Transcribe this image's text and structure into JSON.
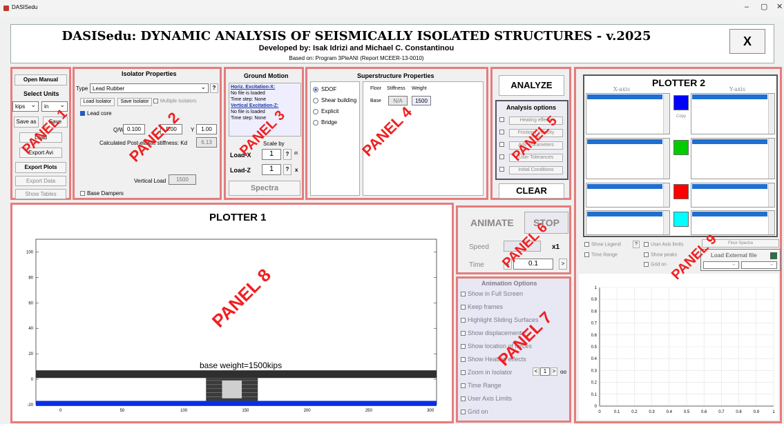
{
  "window": {
    "title": "DASISedu",
    "controls": [
      "–",
      "▢",
      "✕"
    ]
  },
  "header": {
    "title": "DASISedu: DYNAMIC ANALYSIS OF SEISMICALLY ISOLATED STRUCTURES - v.2025",
    "developers": "Developed by: Isak Idrizi and Michael C. Constantinou",
    "based_on": "Based on: Program 3PleANI (Report MCEER-13-0010)",
    "close_label": "X"
  },
  "panel_labels": [
    "PANEL 1",
    "PANEL 2",
    "PANEL 3",
    "PANEL 4",
    "PANEL 5",
    "PANEL 6",
    "PANEL 7",
    "PANEL 8",
    "PANEL 9"
  ],
  "panel1": {
    "open_manual": "Open Manual",
    "select_units": "Select Units",
    "unit_force": "kips",
    "unit_length": "in",
    "save_as": "Save as",
    "save": "Save",
    "load": "Load",
    "export_avi": "Export Avi",
    "export_plots": "Export Plots",
    "export_data": "Export Data",
    "show_tables": "Show Tables"
  },
  "panel2": {
    "title": "Isolator Properties",
    "type_label": "Type",
    "type_value": "Lead Rubber",
    "help": "?",
    "load_isolator": "Load Isolator",
    "save_isolator": "Save Isolator",
    "multiple_isolators": "Multiple Isolators",
    "lead_core": "Lead core",
    "qw_label": "Q/W",
    "qw_value": "0.100",
    "mid_value": "5.00",
    "y_label": "Y",
    "y_value": "1.00",
    "kd_label": "Calculated Post-elastic stiffness: Kd",
    "kd_value": "6.13",
    "vertical_load_label": "Vertical Load",
    "vertical_load_value": "1500",
    "base_dampers": "Base Dampers"
  },
  "panel3": {
    "title": "Ground Motion",
    "horiz_title": "Horiz. Excitation-X:",
    "horiz_file": "No file is loaded",
    "horiz_step": "Time step: None",
    "vert_title": "Vertical Excitation-Z:",
    "vert_file": "No file is loaded",
    "vert_step": "Time step: None",
    "scale_by": "Scale by",
    "load_x": "Load-X",
    "load_x_value": "1",
    "load_z": "Load-Z",
    "load_z_value": "1",
    "help": "?",
    "x_btn_1": "dt",
    "x_btn_2": "x",
    "spectra": "Spectra"
  },
  "panel4": {
    "title": "Superstructure Properties",
    "options": [
      "SDOF",
      "Shear building",
      "Explicit",
      "Bridge"
    ],
    "selected_option": "SDOF",
    "col_floor": "Floor",
    "col_stiffness": "Stiffness",
    "col_weight": "Weight",
    "row_label": "Base",
    "row_stiffness": "N/A",
    "row_weight": "1500"
  },
  "panel5": {
    "analyze": "ANALYZE",
    "options_title": "Analysis options",
    "options": [
      "Heating effects",
      "Friction | Velocity",
      "Adv. Parameters",
      "User Tolerances",
      "Initial Conditions"
    ],
    "clear": "CLEAR"
  },
  "panel6": {
    "animate": "ANIMATE",
    "stop": "STOP",
    "speed_label": "Speed",
    "speed_mult": "x1",
    "time_label": "Time",
    "time_value": "0.1",
    "prev": "<",
    "next": ">"
  },
  "panel7": {
    "title": "Animation Options",
    "options": [
      "Show in Full Screen",
      "Keep frames",
      "Highlight Sliding Surfaces",
      "Show displacements",
      "Show location of forces",
      "Show Heating effects",
      "Zoom in Isolator",
      "Time Range",
      "User Axis Limits",
      "Grid on"
    ],
    "zoom_value": "1",
    "zoom_prev": "<",
    "zoom_next": ">",
    "zoom_oo": "oo"
  },
  "panel8": {
    "title": "PLOTTER 1",
    "caption": "base weight=1500kips",
    "y_ticks": [
      "100",
      "80",
      "60",
      "40",
      "20",
      "0",
      "-20"
    ],
    "x_ticks": [
      "0",
      "50",
      "100",
      "150",
      "200",
      "250",
      "300"
    ],
    "x_range": [
      -20,
      305
    ],
    "y_range": [
      -20,
      110
    ]
  },
  "panel9": {
    "title": "PLOTTER 2",
    "x_axis": "X-axis",
    "y_axis": "Y-axis",
    "copy": "Copy",
    "swatch_colors": [
      "#0000ff",
      "#00cc00",
      "#ff0000",
      "#00ffff"
    ],
    "show_legend": "Show Legend",
    "help": "?",
    "user_axis_limits": "User Axis limits",
    "floor_spectra": "Floor Spectra",
    "time_range": "Time Range",
    "show_peaks": "Show peaks",
    "load_external": "Load External file",
    "grid_on": "Grid on",
    "x_ticks": [
      "0",
      "0.1",
      "0.2",
      "0.3",
      "0.4",
      "0.5",
      "0.6",
      "0.7",
      "0.8",
      "0.9",
      "1"
    ],
    "y_ticks": [
      "1",
      "0.9",
      "0.8",
      "0.7",
      "0.6",
      "0.5",
      "0.4",
      "0.3",
      "0.2",
      "0.1",
      "0"
    ],
    "x_range": [
      0,
      1
    ],
    "y_range": [
      0,
      1
    ],
    "grid": true
  }
}
